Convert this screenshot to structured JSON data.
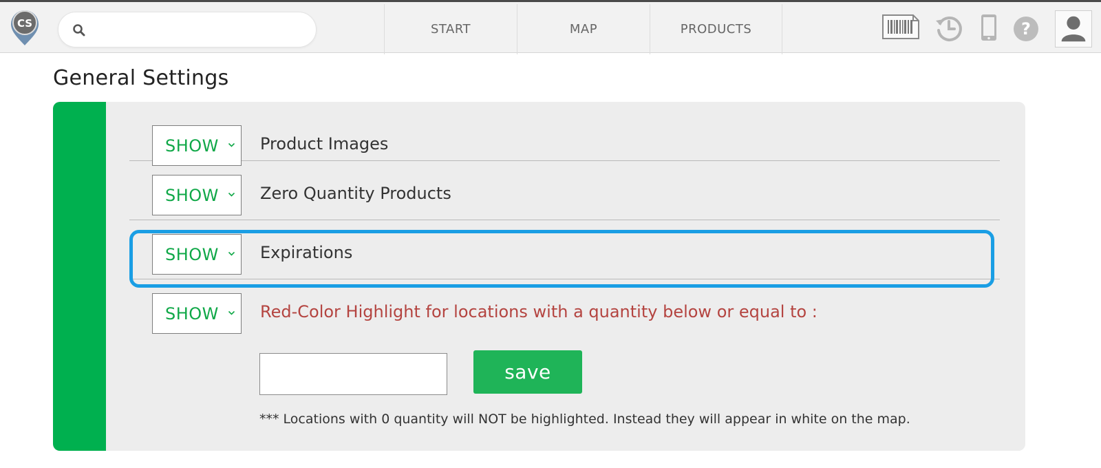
{
  "header": {
    "logo_text": "CS",
    "search": {
      "value": "",
      "placeholder": ""
    },
    "nav": [
      {
        "label": "START"
      },
      {
        "label": "MAP"
      },
      {
        "label": "PRODUCTS"
      }
    ],
    "icons": [
      "barcode-icon",
      "history-icon",
      "phone-icon",
      "help-icon",
      "user-icon"
    ]
  },
  "page": {
    "title": "General Settings"
  },
  "settings": {
    "rows": [
      {
        "value": "SHOW",
        "label": "Product Images"
      },
      {
        "value": "SHOW",
        "label": "Zero Quantity Products"
      },
      {
        "value": "SHOW",
        "label": "Expirations"
      },
      {
        "value": "SHOW",
        "label": "Red-Color Highlight for locations with a quantity below or equal to :"
      }
    ],
    "quantity_input": {
      "value": ""
    },
    "save_label": "save",
    "note": "*** Locations with 0 quantity will NOT be highlighted. Instead they will appear in white on the map."
  },
  "colors": {
    "accent_green": "#00b04f",
    "option_green": "#10a848",
    "highlight_blue": "#1a9ee4",
    "warning_red": "#b44440"
  }
}
